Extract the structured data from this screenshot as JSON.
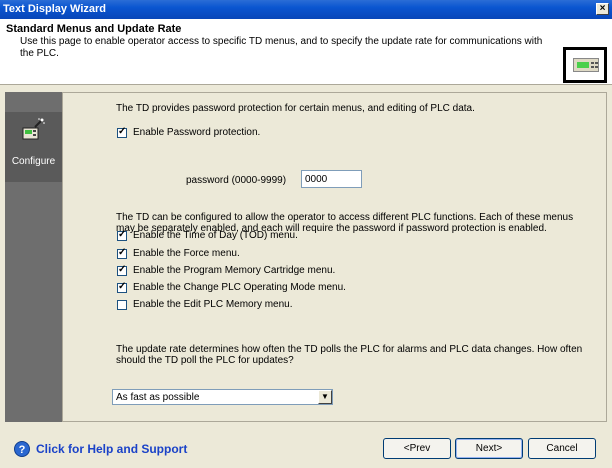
{
  "window": {
    "title": "Text Display Wizard",
    "close_glyph": "×"
  },
  "header": {
    "title": "Standard Menus and Update Rate",
    "description": "Use this page to enable operator access to specific TD menus, and to specify the update rate for communications with the PLC.",
    "icon": "text-display-device-icon"
  },
  "sidebar": {
    "items": [
      {
        "label": "Configure",
        "icon": "configure-wand-icon"
      }
    ]
  },
  "content": {
    "password_intro": "The TD provides password protection for certain menus, and editing of PLC data.",
    "enable_password": {
      "label": "Enable Password protection.",
      "checked": true
    },
    "password_field": {
      "label": "password (0000-9999)",
      "value": "0000"
    },
    "menus_intro": "The TD can be configured to allow the operator to access different PLC functions. Each of these menus may be separately enabled, and each will require the password if password protection is enabled.",
    "menus": [
      {
        "label": "Enable the Time of Day (TOD) menu.",
        "checked": true
      },
      {
        "label": "Enable the Force menu.",
        "checked": true
      },
      {
        "label": "Enable the Program Memory Cartridge menu.",
        "checked": true
      },
      {
        "label": "Enable the Change PLC Operating Mode menu.",
        "checked": true
      },
      {
        "label": "Enable the Edit PLC Memory menu.",
        "checked": false
      }
    ],
    "update_intro": "The update rate determines how often the TD polls the PLC for alarms and PLC data changes. How often should the TD poll the PLC for updates?",
    "update_rate": {
      "value": "As fast as possible"
    }
  },
  "footer": {
    "help_label": "Click for Help and Support",
    "prev_label": "<Prev",
    "next_label": "Next>",
    "cancel_label": "Cancel"
  },
  "colors": {
    "titlebar": "#0a55d0",
    "sidebar": "#6e6e6e",
    "help_link": "#1a42c8"
  }
}
